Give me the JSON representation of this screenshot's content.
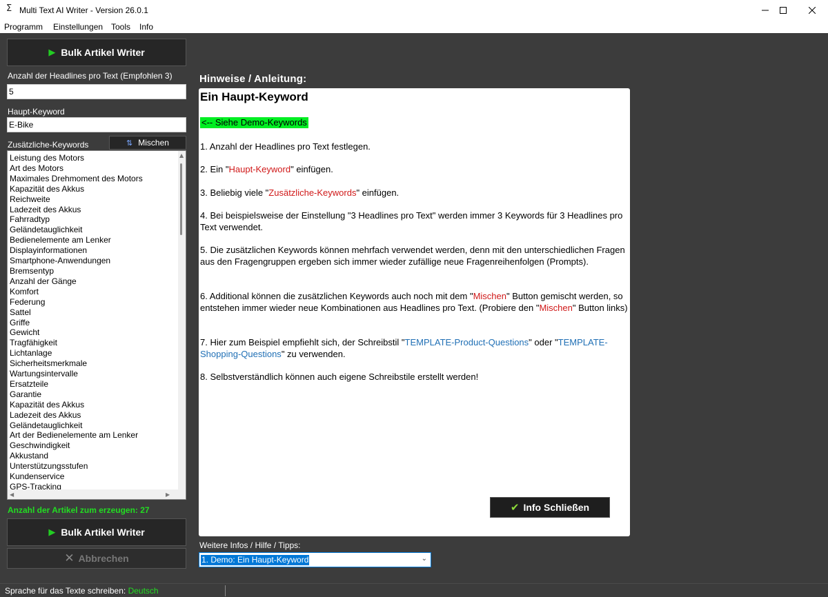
{
  "window": {
    "title": "Multi Text AI Writer - Version 26.0.1",
    "app_icon": "Σ",
    "controls": [
      "minimize-icon",
      "maximize-icon",
      "close-icon"
    ]
  },
  "menu": [
    "Programm",
    "Einstellungen",
    "Tools",
    "Info"
  ],
  "sidebar": {
    "top_button": "Bulk Artikel Writer",
    "headlines_label": "Anzahl der Headlines pro Text (Empfohlen 3)",
    "headlines_value": "5",
    "main_keyword_label": "Haupt-Keyword",
    "main_keyword_value": "E-Bike",
    "extra_keywords_label": "Zusätzliche-Keywords",
    "mix_button": "Mischen",
    "keywords": [
      "Leistung des Motors",
      "Art des Motors",
      "Maximales Drehmoment des Motors",
      "Kapazität des Akkus",
      "Reichweite",
      "Ladezeit des Akkus",
      "Fahrradtyp",
      "Geländetauglichkeit",
      "Bedienelemente am Lenker",
      "Displayinformationen",
      "Smartphone-Anwendungen",
      "Bremsentyp",
      "Anzahl der Gänge",
      "Komfort",
      "Federung",
      "Sattel",
      "Griffe",
      "Gewicht",
      "Tragfähigkeit",
      "Lichtanlage",
      "Sicherheitsmerkmale",
      "Wartungsintervalle",
      "Ersatzteile",
      "Garantie",
      "Kapazität des Akkus",
      "Ladezeit des Akkus",
      "Geländetauglichkeit",
      "Art der Bedienelemente am Lenker",
      "Geschwindigkeit",
      "Akkustand",
      "Unterstützungsstufen",
      "Kundenservice",
      "GPS-Tracking"
    ],
    "article_count": "Anzahl der Artikel zum erzeugen: 27",
    "bottom_button": "Bulk Artikel Writer",
    "cancel_button": "Abbrechen"
  },
  "hints": {
    "title": "Hinweise / Anleitung:",
    "heading": "Ein Haupt-Keyword",
    "demo_link": "<-- Siehe Demo-Keywords",
    "p1": "1. Anzahl der Headlines pro Text festlegen.",
    "p2_a": "2. Ein \"",
    "p2_red": "Haupt-Keyword",
    "p2_b": "\" einfügen.",
    "p3_a": "3. Beliebig viele \"",
    "p3_red": "Zusätzliche-Keywords",
    "p3_b": "\" einfügen.",
    "p4": "4. Bei beispielsweise der Einstellung \"3 Headlines pro Text\" werden immer 3 Keywords für 3 Headlines pro Text verwendet.",
    "p5": "5. Die zusätzlichen Keywords können mehrfach verwendet werden, denn mit den unterschiedlichen Fragen aus den Fragengruppen ergeben sich immer wieder zufällige neue Fragenreihenfolgen (Prompts).",
    "p6_a": "6. Additional können die zusätzlichen Keywords auch noch mit dem \"",
    "p6_red1": "Mischen",
    "p6_b": "\" Button gemischt werden, so entstehen immer wieder neue Kombinationen aus Headlines pro Text. (Probiere den \"",
    "p6_red2": "Mischen",
    "p6_c": "\" Button links)",
    "p7_a": "7. Hier zum Beispiel empfiehlt sich, der Schreibstil \"",
    "p7_blue1": "TEMPLATE-Product-Questions",
    "p7_b": "\" oder \"",
    "p7_blue2": "TEMPLATE-Shopping-Questions",
    "p7_c": "\" zu verwenden.",
    "p8": "8. Selbstverständlich können auch eigene Schreibstile erstellt werden!",
    "close_button": "Info Schließen"
  },
  "more": {
    "label": "Weitere Infos / Hilfe / Tipps:",
    "selected": "1. Demo: Ein Haupt-Keyword"
  },
  "status": {
    "text": "Sprache für das Texte schreiben:",
    "language": "Deutsch"
  },
  "colors": {
    "accent_green": "#22dd22",
    "highlight_red": "#d01818",
    "link_blue": "#1f6fb5",
    "select_blue": "#0078d7"
  }
}
